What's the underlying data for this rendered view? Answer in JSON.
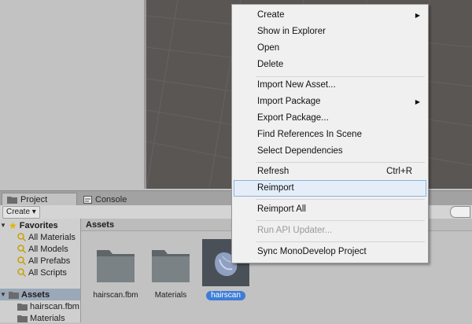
{
  "tabs": {
    "project": "Project",
    "console": "Console"
  },
  "toolbar": {
    "create_label": "Create ▾"
  },
  "tree": {
    "favorites": "Favorites",
    "fav_items": [
      "All Materials",
      "All Models",
      "All Prefabs",
      "All Scripts"
    ],
    "assets": "Assets",
    "asset_items": [
      "hairscan.fbm",
      "Materials"
    ]
  },
  "assets_panel": {
    "header": "Assets",
    "items": [
      "hairscan.fbm",
      "Materials",
      "hairscan"
    ]
  },
  "context_menu": {
    "create": "Create",
    "show_in_explorer": "Show in Explorer",
    "open": "Open",
    "delete": "Delete",
    "import_new_asset": "Import New Asset...",
    "import_package": "Import Package",
    "export_package": "Export Package...",
    "find_references": "Find References In Scene",
    "select_dependencies": "Select Dependencies",
    "refresh": "Refresh",
    "refresh_shortcut": "Ctrl+R",
    "reimport": "Reimport",
    "reimport_all": "Reimport All",
    "run_api_updater": "Run API Updater...",
    "sync_monodevelop": "Sync MonoDevelop Project"
  },
  "colors": {
    "menu_highlight": "#e5eef8",
    "selection_blue": "#3d7dd8",
    "scene_bg": "#5a5654"
  }
}
